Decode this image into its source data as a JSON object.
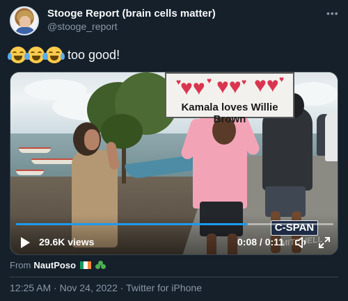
{
  "author": {
    "display_name": "Stooge Report (brain cells matter)",
    "handle": "@stooge_report",
    "avatar_icon": "avatar-photo"
  },
  "tweet": {
    "emojis": [
      "face-with-tears-of-joy",
      "face-with-tears-of-joy",
      "face-with-tears-of-joy"
    ],
    "text": "too good!"
  },
  "video": {
    "sign_text": "Kamala loves Willie Brown",
    "views": "29.6K views",
    "time": "0:08 / 0:11",
    "progress": 0.73,
    "logo": "C-SPAN",
    "watermark": "MITCHELL"
  },
  "attribution": {
    "prefix": "From",
    "name": "NautPoso",
    "flag_colors": [
      "#169b62",
      "#ffffff",
      "#ff883e"
    ]
  },
  "meta": {
    "timestamp": "12:25 AM · Nov 24, 2022 · Twitter for iPhone"
  },
  "colors": {
    "background": "#15202b",
    "text_primary": "#f7f9f9",
    "text_secondary": "#8b98a5",
    "accent": "#1d9bf0"
  }
}
